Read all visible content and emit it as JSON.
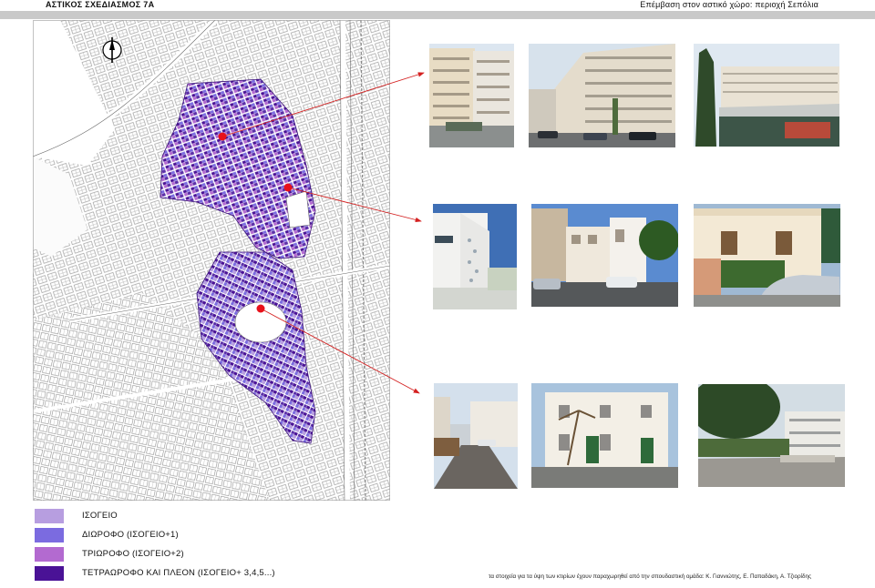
{
  "header": {
    "left_title": "ΑΣΤΙΚΟΣ ΣΧΕΔΙΑΣΜΟΣ 7Α",
    "right_title": "Επέμβαση στον αστικό χώρο: περιοχή Σεπόλια"
  },
  "map": {
    "north_icon": "north-arrow-icon",
    "markers": 3,
    "marked_area_color": "#5b2fa8"
  },
  "photos": {
    "count": 9,
    "groups": [
      "row-1",
      "row-2",
      "row-3"
    ]
  },
  "legend": [
    {
      "label": "ΙΣΟΓΕΙΟ",
      "color": "#b79ee0"
    },
    {
      "label": "ΔΙΩΡΟΦΟ (ΙΣΟΓΕΙΟ+1)",
      "color": "#7b6be0"
    },
    {
      "label": "ΤΡΙΩΡΟΦΟ (ΙΣΟΓΕΙΟ+2)",
      "color": "#b36ad0"
    },
    {
      "label": "ΤΕΤΡΑΩΡΟΦΟ ΚΑΙ ΠΛΕΟΝ (ΙΣΟΓΕΙΟ+ 3,4,5...)",
      "color": "#4a1296"
    }
  ],
  "credits": "τα στοιχεία για τα ύψη των κτιρίων έχουν παραχωρηθεί από την σπουδαστική ομάδα: Κ. Γιαννιώτης, Ε. Παπαδάκη, Α. Τζιορίδης",
  "colors": {
    "marker": "#e8111a",
    "arrow": "#d42020",
    "header_bar": "#c9c9c9"
  }
}
